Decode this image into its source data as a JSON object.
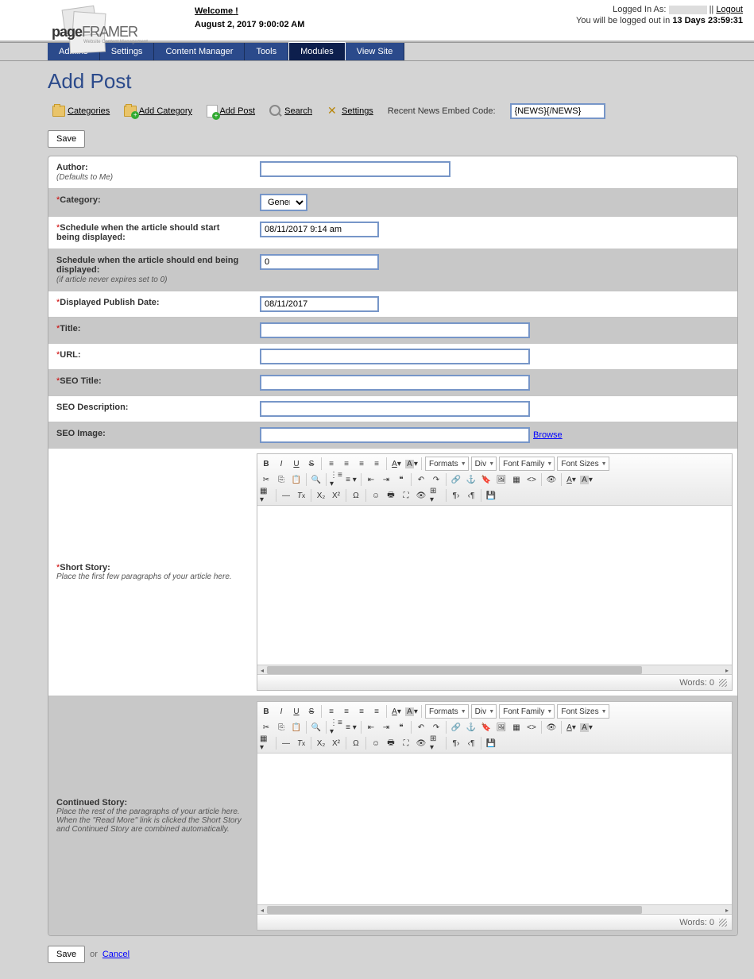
{
  "header": {
    "welcome": "Welcome",
    "welcome_user": "",
    "datetime": "August 2, 2017 9:00:02 AM",
    "logged_in_prefix": "Logged In As:",
    "logged_in_user": "",
    "logout": "Logout",
    "countdown_prefix": "You will be logged out in",
    "countdown_value": "13 Days 23:59:31",
    "logo_main": "pageFRAMER",
    "logo_sub": "Website Content Management"
  },
  "nav": {
    "tabs": [
      "Admins",
      "Settings",
      "Content Manager",
      "Tools",
      "Modules",
      "View Site"
    ],
    "active": 4
  },
  "page": {
    "title": "Add Post"
  },
  "toolbar": {
    "categories": "Categories",
    "add_category": "Add Category",
    "add_post": "Add Post",
    "search": "Search",
    "settings": "Settings",
    "embed_label": "Recent News Embed Code:",
    "embed_value": "{NEWS}{/NEWS}"
  },
  "buttons": {
    "save": "Save",
    "cancel": "Cancel",
    "or": "or"
  },
  "form": {
    "author": {
      "label": "Author:",
      "hint": "(Defaults to Me)",
      "value": ""
    },
    "category": {
      "label": "Category:",
      "value": "General"
    },
    "start": {
      "label": "Schedule when the article should start being displayed:",
      "value": "08/11/2017 9:14 am"
    },
    "end": {
      "label": "Schedule when the article should end being displayed:",
      "hint": "(if article never expires set to 0)",
      "value": "0"
    },
    "publish": {
      "label": "Displayed Publish Date:",
      "value": "08/11/2017"
    },
    "title": {
      "label": "Title:",
      "value": ""
    },
    "url": {
      "label": "URL:",
      "value": ""
    },
    "seo_title": {
      "label": "SEO Title:",
      "value": ""
    },
    "seo_desc": {
      "label": "SEO Description:",
      "value": ""
    },
    "seo_image": {
      "label": "SEO Image:",
      "value": "",
      "browse": "Browse"
    },
    "short": {
      "label": "Short Story:",
      "hint": "Place the first few paragraphs of your article here."
    },
    "continued": {
      "label": "Continued Story:",
      "hint": "Place the rest of the paragraphs of your article here. When the \"Read More\" link is clicked the Short Story and Continued Story are combined automatically."
    }
  },
  "editor": {
    "formats": "Formats",
    "div": "Div",
    "font_family": "Font Family",
    "font_sizes": "Font Sizes",
    "words_label": "Words:",
    "words_count": "0"
  }
}
